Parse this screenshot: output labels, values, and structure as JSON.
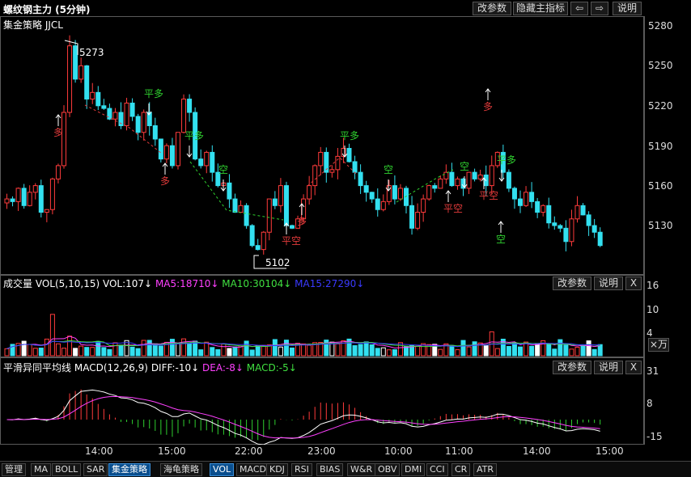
{
  "window": {
    "title": "螺纹钢主力 (5分钟)",
    "buttons": {
      "params": "改参数",
      "hide_indicator": "隐藏主指标",
      "help": "说明"
    },
    "strategy_label": "集金策略 JJCL"
  },
  "main_chart": {
    "price_labels": [
      "5280",
      "5250",
      "5220",
      "5190",
      "5160",
      "5130"
    ],
    "high_label": "5273",
    "low_label": "5102",
    "signals": [
      {
        "text": "多",
        "color": "#e23b3b"
      },
      {
        "text": "平多",
        "color": "#2fd02f"
      },
      {
        "text": "多",
        "color": "#e23b3b"
      },
      {
        "text": "平多",
        "color": "#2fd02f"
      },
      {
        "text": "空",
        "color": "#2fd02f"
      },
      {
        "text": "平空",
        "color": "#e23b3b"
      },
      {
        "text": "多",
        "color": "#e23b3b"
      },
      {
        "text": "平多",
        "color": "#2fd02f"
      },
      {
        "text": "空",
        "color": "#2fd02f"
      },
      {
        "text": "平空",
        "color": "#e23b3b"
      },
      {
        "text": "空",
        "color": "#2fd02f"
      },
      {
        "text": "多",
        "color": "#e23b3b"
      },
      {
        "text": "平空",
        "color": "#e23b3b"
      },
      {
        "text": "平多",
        "color": "#2fd02f"
      },
      {
        "text": "空",
        "color": "#2fd02f"
      }
    ]
  },
  "volume_panel": {
    "name": "成交量",
    "params": "VOL(5,10,15)",
    "vol": "VOL:107↓",
    "ma5": "MA5:18710↓",
    "ma10": "MA10:30104↓",
    "ma15": "MA15:27290↓",
    "axis_labels": [
      "16",
      "10",
      "4"
    ],
    "unit": "×万",
    "buttons": {
      "params": "改参数",
      "help": "说明",
      "close": "X"
    }
  },
  "macd_panel": {
    "name": "平滑异同平均线",
    "params": "MACD(12,26,9)",
    "diff": "DIFF:-10↓",
    "dea": "DEA:-8↓",
    "macd": "MACD:-5↓",
    "axis_labels": [
      "31",
      "8",
      "-15"
    ],
    "buttons": {
      "params": "改参数",
      "help": "说明",
      "close": "X"
    }
  },
  "time_axis": [
    "14:00",
    "15:00",
    "22:00",
    "23:00",
    "10:00",
    "11:00",
    "14:00",
    "15:00"
  ],
  "tabs": [
    "管理",
    "MA",
    "BOLL",
    "SAR",
    "集金策略",
    "海龟策略",
    "VOL",
    "MACD",
    "KDJ",
    "RSI",
    "BIAS",
    "W&R",
    "OBV",
    "DMI",
    "CCI",
    "CR",
    "ATR"
  ],
  "active_tabs": [
    "集金策略",
    "VOL"
  ],
  "colors": {
    "up": "#ff3b3b",
    "down": "#33e0f0",
    "ma5": "#ff40ff",
    "ma10": "#40e040",
    "ma15": "#3a3aff",
    "dea": "#ff40ff"
  }
}
